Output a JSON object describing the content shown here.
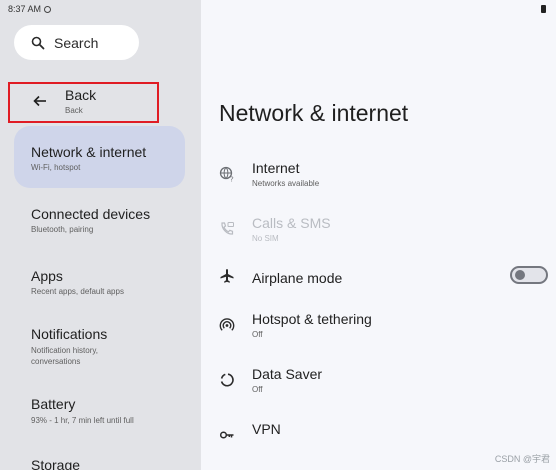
{
  "status_bar": {
    "time": "8:37 AM"
  },
  "sidebar": {
    "search_label": "Search",
    "back": {
      "title": "Back",
      "subtitle": "Back"
    },
    "items": [
      {
        "title": "Network & internet",
        "subtitle": "Wi-Fi, hotspot"
      },
      {
        "title": "Connected devices",
        "subtitle": "Bluetooth, pairing"
      },
      {
        "title": "Apps",
        "subtitle": "Recent apps, default apps"
      },
      {
        "title": "Notifications",
        "subtitle": "Notification history, conversations"
      },
      {
        "title": "Battery",
        "subtitle": "93% - 1 hr, 7 min left until full"
      },
      {
        "title": "Storage",
        "subtitle": ""
      }
    ]
  },
  "main": {
    "page_title": "Network & internet",
    "rows": [
      {
        "title": "Internet",
        "subtitle": "Networks available",
        "icon": "globe-wifi-icon",
        "enabled": true
      },
      {
        "title": "Calls & SMS",
        "subtitle": "No SIM",
        "icon": "calls-sms-icon",
        "enabled": false
      },
      {
        "title": "Airplane mode",
        "subtitle": "",
        "icon": "airplane-icon",
        "enabled": true,
        "toggle": false
      },
      {
        "title": "Hotspot & tethering",
        "subtitle": "Off",
        "icon": "hotspot-icon",
        "enabled": true
      },
      {
        "title": "Data Saver",
        "subtitle": "Off",
        "icon": "data-saver-icon",
        "enabled": true
      },
      {
        "title": "VPN",
        "subtitle": "",
        "icon": "vpn-key-icon",
        "enabled": true
      }
    ]
  },
  "watermark": "CSDN @宇君",
  "colors": {
    "sidebar_bg": "#e2e3e7",
    "active_item_bg": "#cfd5ea",
    "content_bg": "#f6f7fb",
    "highlight_border": "#e01c24"
  }
}
